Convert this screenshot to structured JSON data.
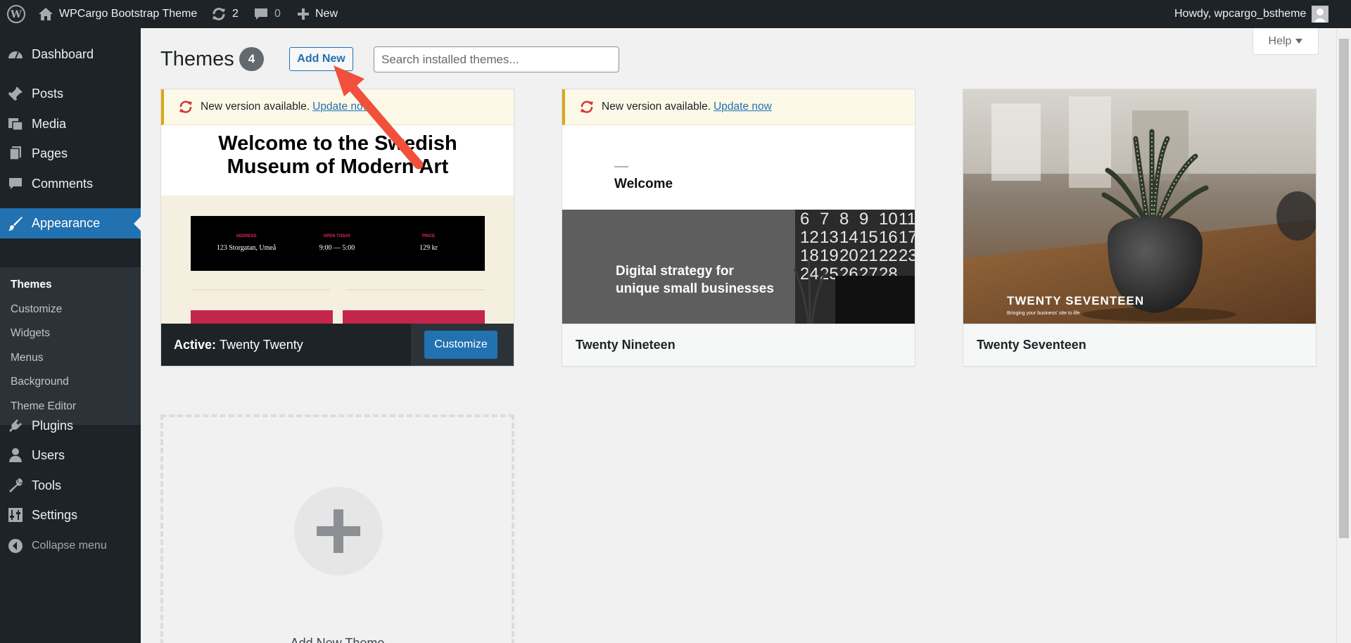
{
  "adminbar": {
    "site_name": "WPCargo Bootstrap Theme",
    "updates_count": "2",
    "comments_count": "0",
    "new_label": "New",
    "howdy": "Howdy, wpcargo_bstheme"
  },
  "menu": {
    "dashboard": "Dashboard",
    "posts": "Posts",
    "media": "Media",
    "pages": "Pages",
    "comments": "Comments",
    "appearance": "Appearance",
    "sub": {
      "themes": "Themes",
      "customize": "Customize",
      "widgets": "Widgets",
      "menus": "Menus",
      "background": "Background",
      "theme_editor": "Theme Editor"
    },
    "plugins": "Plugins",
    "users": "Users",
    "tools": "Tools",
    "settings": "Settings",
    "collapse": "Collapse menu"
  },
  "header": {
    "title": "Themes",
    "count": "4",
    "add_new": "Add New",
    "search_placeholder": "Search installed themes...",
    "help": "Help"
  },
  "themes": {
    "notice_text": "New version available.",
    "notice_link": "Update now",
    "active": {
      "prefix": "Active:",
      "name": "Twenty Twenty",
      "customize": "Customize",
      "preview": {
        "headline_1": "Welcome to the Swedish",
        "headline_2": "Museum of Modern Art",
        "address_label": "ADDRESS",
        "address_value": "123 Storgatan, Umeå",
        "open_label": "OPEN TODAY",
        "open_value": "9:00 — 5:00",
        "price_label": "PRICE",
        "price_value": "129 kr"
      }
    },
    "nineteen": {
      "name": "Twenty Nineteen",
      "preview": {
        "welcome": "Welcome",
        "tagline_1": "Digital strategy for",
        "tagline_2": "unique small businesses",
        "calendar": [
          "6",
          "7",
          "8",
          "9",
          "10",
          "11",
          "12",
          "13",
          "14",
          "15",
          "16",
          "17",
          "18",
          "19",
          "20",
          "21",
          "22",
          "23",
          "24",
          "25",
          "26",
          "27",
          "28"
        ]
      }
    },
    "seventeen": {
      "name": "Twenty Seventeen",
      "preview": {
        "brand": "TWENTY SEVENTEEN",
        "tagline": "Bringing your business' site to life"
      }
    },
    "add_new_theme": "Add New Theme"
  },
  "colors": {
    "admin_dark": "#1d2327",
    "accent_blue": "#2271b1",
    "notice_yellow": "#dba617",
    "update_orange": "#d63638",
    "arrow_red": "#f0503c"
  }
}
